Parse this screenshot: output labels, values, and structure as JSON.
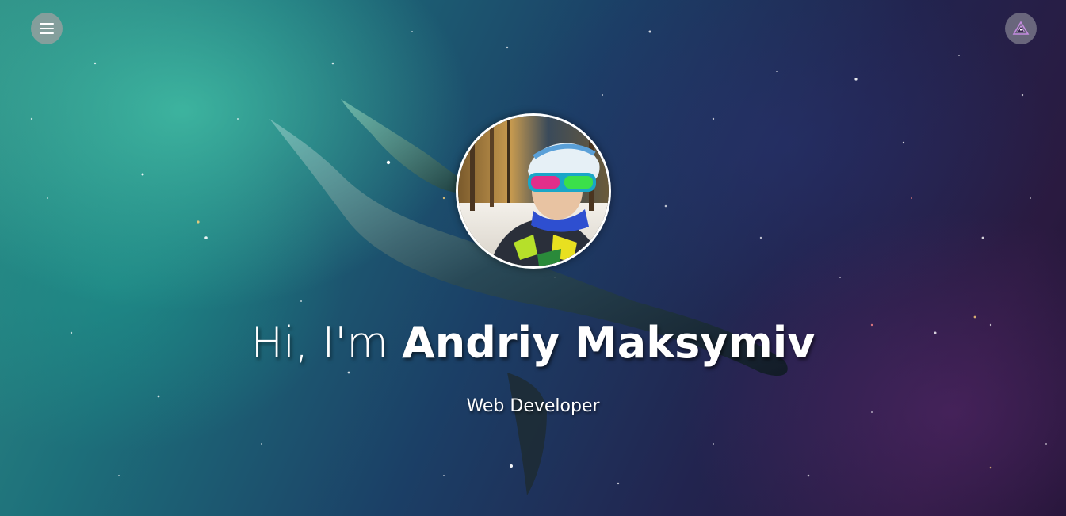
{
  "header": {
    "menu_icon": "hamburger-menu-icon",
    "logo_icon": "triangle-logo-icon"
  },
  "hero": {
    "greeting": "Hi, I'm",
    "name": "Andriy Maksymiv",
    "subtitle": "Web Developer",
    "avatar_icon": "profile-photo"
  },
  "colors": {
    "text": "#ffffff",
    "button_bg": "#a0a0a0",
    "logo_accent": "#c48adf"
  }
}
